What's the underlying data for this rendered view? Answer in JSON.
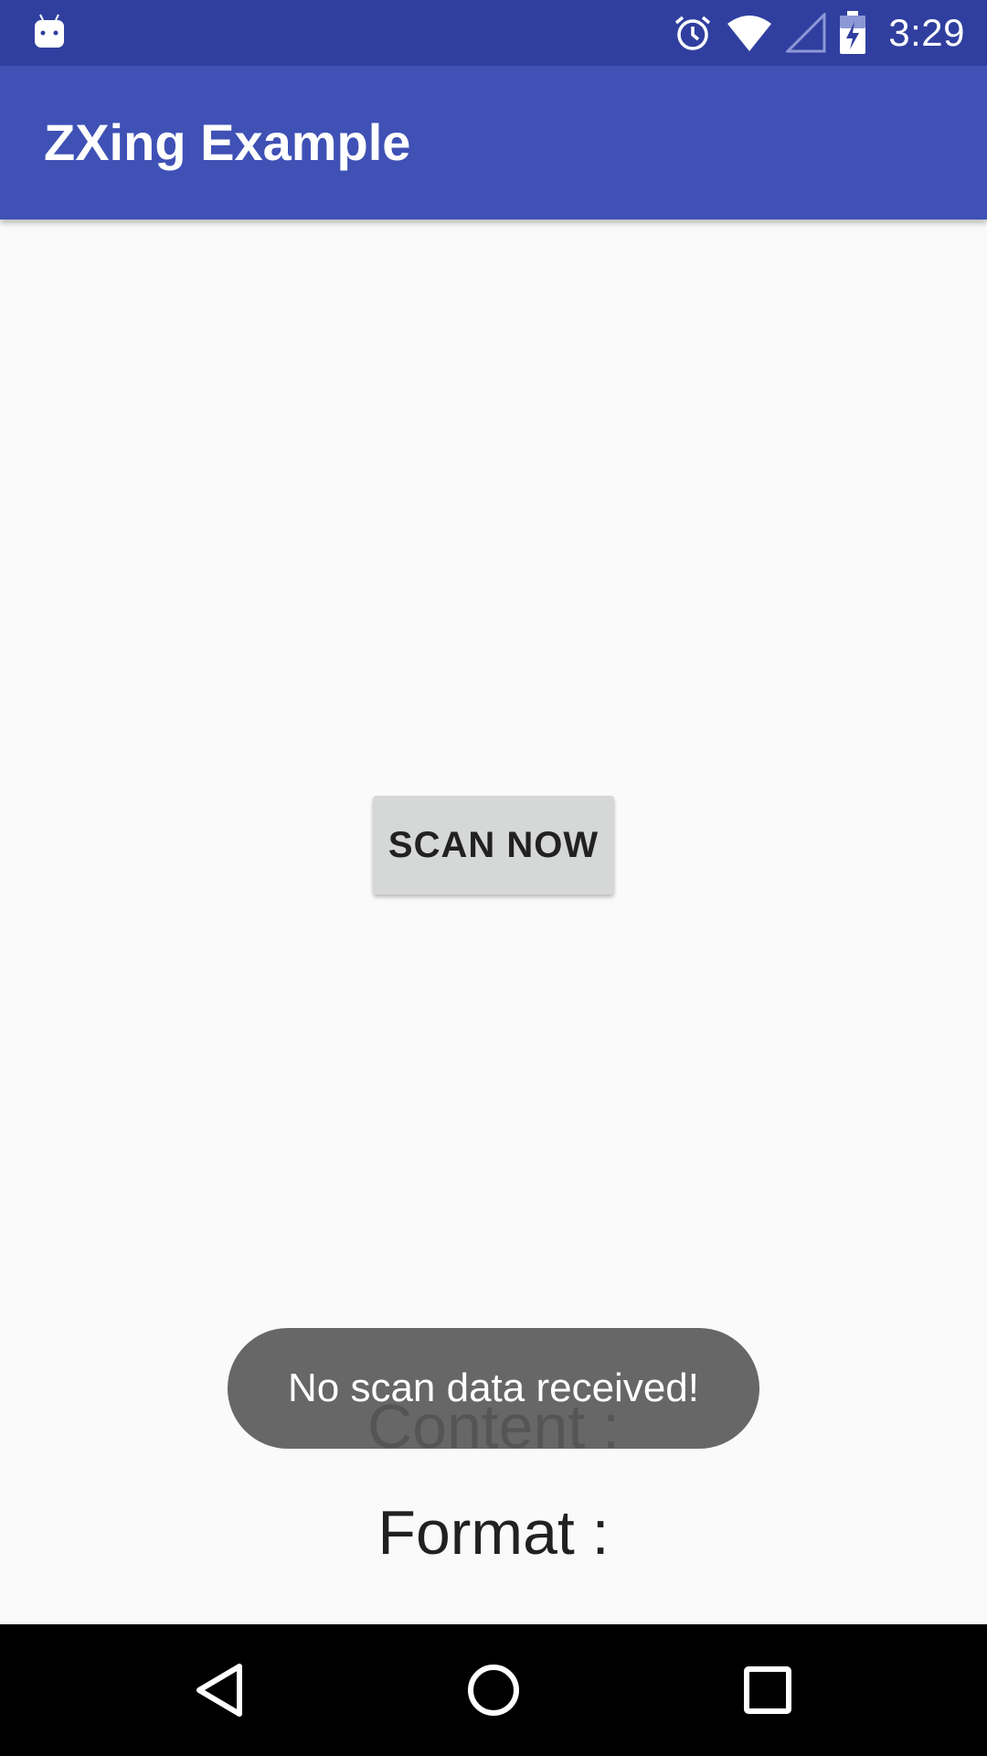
{
  "status_bar": {
    "time": "3:29",
    "icons": [
      "android-debug-icon",
      "alarm-icon",
      "wifi-icon",
      "cell-signal-icon",
      "battery-charging-icon"
    ]
  },
  "app_bar": {
    "title": "ZXing Example",
    "color": "#3f51b5"
  },
  "main": {
    "scan_button_label": "SCAN NOW",
    "content_label": "Content :",
    "format_label": "Format :"
  },
  "toast": {
    "message": "No scan data received!"
  },
  "nav_bar": {
    "icons": [
      "back-icon",
      "home-icon",
      "recents-icon"
    ]
  },
  "colors": {
    "status_bar": "#303f9f",
    "app_bar": "#3f51b5",
    "background": "#fafafa",
    "button": "#d6d7d7"
  }
}
